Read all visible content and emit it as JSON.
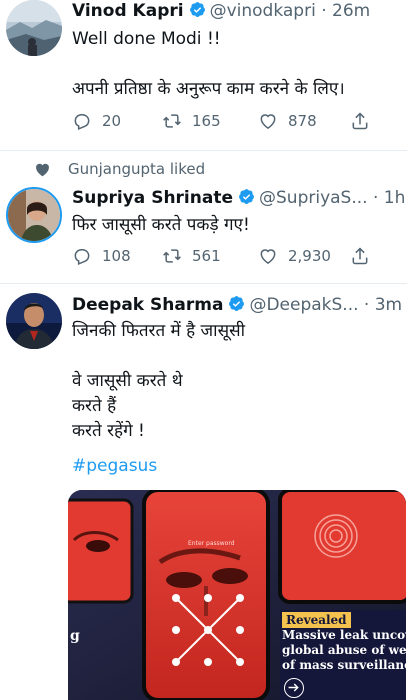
{
  "tweets": [
    {
      "name": "Vinod Kapri",
      "handle": "@vinodkapri",
      "time": "26m",
      "body": "Well done Modi !!\n\nअपनी प्रतिष्ठा के अनुरूप काम करने के लिए।",
      "replies": "20",
      "retweets": "165",
      "likes": "878"
    },
    {
      "liked_by": "Gunjangupta liked",
      "name": "Supriya Shrinate",
      "handle": "@SupriyaS...",
      "time": "1h",
      "body": "फिर जासूसी करते पकड़े गए!",
      "replies": "108",
      "retweets": "561",
      "likes": "2,930"
    },
    {
      "name": "Deepak Sharma",
      "handle": "@DeepakS...",
      "time": "3m",
      "body": "जिनकी फितरत में है जासूसी\n\nवे  जासूसी करते थे\nकरते हैं\nकरते रहेंगे !",
      "hashtag": "#pegasus",
      "media": {
        "screen_text": "Enter password",
        "edge_letter": "g",
        "tag": "Revealed",
        "headline_lines": [
          "Massive leak uncove",
          "global abuse of weap",
          "of mass surveillance"
        ]
      }
    }
  ],
  "separator_dot": "·",
  "colors": {
    "accent": "#1d9bf0",
    "muted": "#536471",
    "divider": "#e6ecf0"
  }
}
